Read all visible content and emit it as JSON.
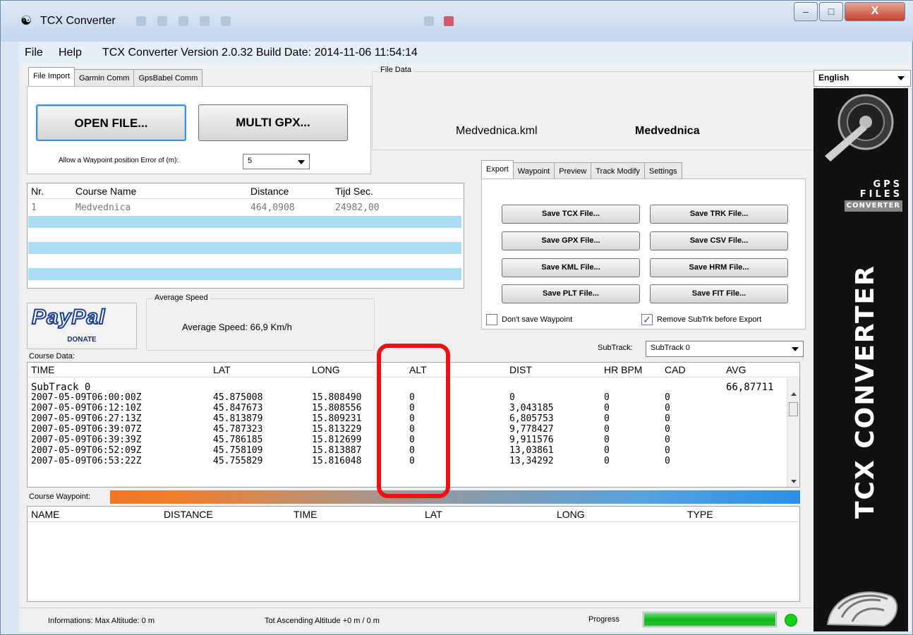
{
  "window": {
    "title": "TCX Converter",
    "minimize": "–",
    "maximize": "□",
    "close": "X"
  },
  "menu": {
    "file": "File",
    "help": "Help",
    "version": "TCX Converter Version 2.0.32 Build Date: 2014-11-06 11:54:14"
  },
  "import_tabs": [
    "File Import",
    "Garmin Comm",
    "GpsBabel Comm"
  ],
  "import": {
    "open_file": "OPEN FILE...",
    "multi_gpx": "MULTI GPX...",
    "waypoint_error_label": "Allow a Waypoint position Error of (m):",
    "waypoint_error_value": "5"
  },
  "file_data": {
    "title": "File Data",
    "filename": "Medvednica.kml",
    "course_name": "Medvednica"
  },
  "language": "English",
  "courses": {
    "headers": [
      "Nr.",
      "Course Name",
      "Distance",
      "Tijd Sec."
    ],
    "rows": [
      [
        "1",
        "Medvednica",
        "464,0908",
        "24982,00"
      ]
    ]
  },
  "export_tabs": [
    "Export",
    "Waypoint",
    "Preview",
    "Track Modify",
    "Settings"
  ],
  "export": {
    "save_tcx": "Save TCX File...",
    "save_trk": "Save TRK File...",
    "save_gpx": "Save GPX File...",
    "save_csv": "Save CSV File...",
    "save_kml": "Save KML File...",
    "save_hrm": "Save HRM File...",
    "save_plt": "Save PLT File...",
    "save_fit": "Save FIT File...",
    "dont_save_waypoint": "Don't save Waypoint",
    "dont_save_waypoint_checked": false,
    "remove_subtrk": "Remove SubTrk before Export",
    "remove_subtrk_checked": true,
    "subtrack_label": "SubTrack:",
    "subtrack_value": "SubTrack 0"
  },
  "paypal": {
    "logo": "PayPal",
    "donate": "DONATE"
  },
  "average_speed": {
    "title": "Average Speed",
    "text": "Average Speed: 66,9 Km/h"
  },
  "course_data": {
    "title": "Course Data:",
    "headers": [
      "TIME",
      "LAT",
      "LONG",
      "ALT",
      "DIST",
      "HR BPM",
      "CAD",
      "AVG"
    ],
    "subtrack": "SubTrack 0",
    "avg_value": "66,87711",
    "rows": [
      [
        "2007-05-09T06:00:00Z",
        "45.875008",
        "15.808490",
        "0",
        "0",
        "0",
        "0"
      ],
      [
        "2007-05-09T06:12:10Z",
        "45.847673",
        "15.808556",
        "0",
        "3,043185",
        "0",
        "0"
      ],
      [
        "2007-05-09T06:27:13Z",
        "45.813879",
        "15.809231",
        "0",
        "6,805753",
        "0",
        "0"
      ],
      [
        "2007-05-09T06:39:07Z",
        "45.787323",
        "15.813229",
        "0",
        "9,778427",
        "0",
        "0"
      ],
      [
        "2007-05-09T06:39:39Z",
        "45.786185",
        "15.812699",
        "0",
        "9,911576",
        "0",
        "0"
      ],
      [
        "2007-05-09T06:52:09Z",
        "45.758109",
        "15.813887",
        "0",
        "13,03861",
        "0",
        "0"
      ],
      [
        "2007-05-09T06:53:22Z",
        "45.755829",
        "15.816048",
        "0",
        "13,34292",
        "0",
        "0"
      ]
    ]
  },
  "course_waypoint": {
    "title": "Course Waypoint:",
    "headers": [
      "NAME",
      "DISTANCE",
      "TIME",
      "LAT",
      "LONG",
      "TYPE"
    ]
  },
  "status": {
    "max_altitude": "Informations:  Max Altitude: 0 m",
    "tot_ascending": "Tot Ascending Altitude +0 m / 0 m",
    "progress_label": "Progress",
    "progress": 1.0
  },
  "sidebar": {
    "gps": "GPS",
    "files": "FILES",
    "converter": "CONVERTER",
    "vertical_title": "TCX CONVERTER"
  },
  "colors": {
    "stripe": "#a9dcf5",
    "progress": "#1fbf2f",
    "status_led": "#19d119",
    "highlight_box": "#ee1111"
  }
}
